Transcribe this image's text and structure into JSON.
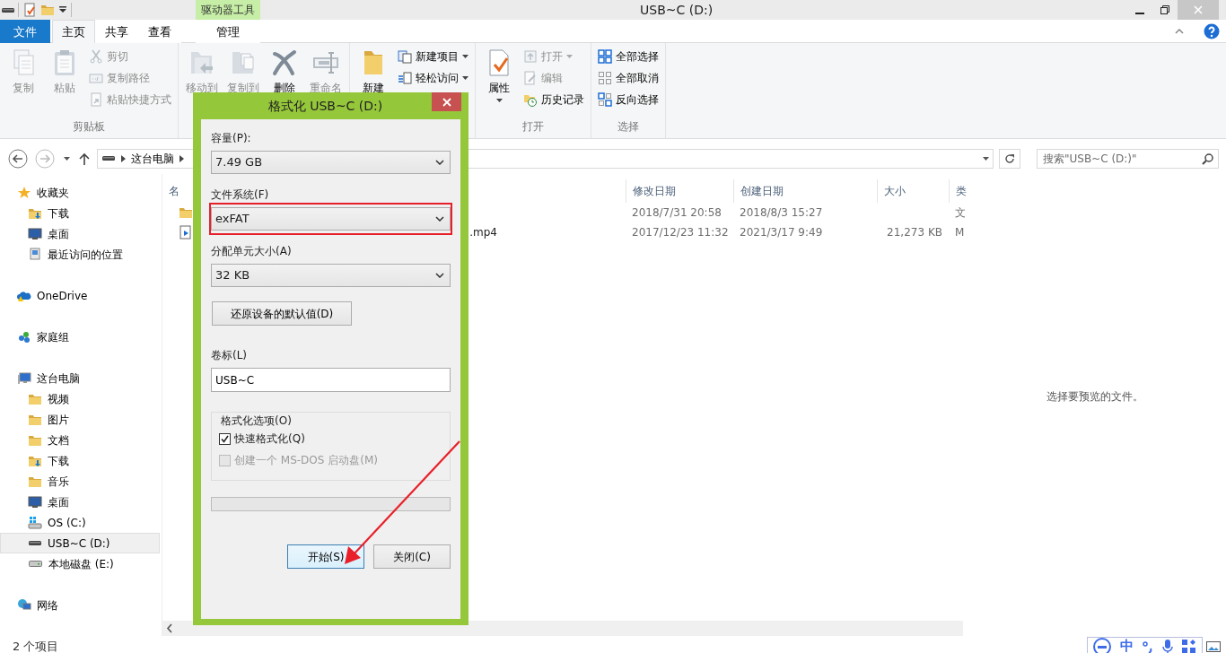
{
  "window": {
    "title": "USB~C (D:)"
  },
  "contextual_header": "驱动器工具",
  "ribbon_tabs": [
    {
      "label": "文件",
      "kind": "file",
      "selected": false
    },
    {
      "label": "主页",
      "kind": "normal",
      "selected": true
    },
    {
      "label": "共享",
      "kind": "normal",
      "selected": false
    },
    {
      "label": "查看",
      "kind": "normal",
      "selected": false
    },
    {
      "label": "管理",
      "kind": "contextual",
      "selected": false
    }
  ],
  "ribbon_groups": [
    {
      "label": "剪贴板",
      "items": [
        {
          "label": "复制",
          "kind": "large",
          "disabled": true,
          "dropdown": false
        },
        {
          "label": "粘贴",
          "kind": "large",
          "disabled": true,
          "dropdown": false
        },
        {
          "label": "剪切",
          "kind": "small",
          "disabled": true,
          "dropdown": false
        },
        {
          "label": "复制路径",
          "kind": "small",
          "disabled": true,
          "dropdown": false
        },
        {
          "label": "粘贴快捷方式",
          "kind": "small",
          "disabled": true,
          "dropdown": false
        }
      ]
    },
    {
      "items": [
        {
          "label": "移动到",
          "kind": "large",
          "disabled": true,
          "dropdown": false
        },
        {
          "label": "复制到",
          "kind": "large",
          "disabled": true,
          "dropdown": false
        },
        {
          "label": "删除",
          "kind": "large",
          "disabled": false,
          "dropdown": false
        },
        {
          "label": "重命名",
          "kind": "large",
          "disabled": true,
          "dropdown": false
        }
      ]
    },
    {
      "items": [
        {
          "label": "新建",
          "kind": "large",
          "disabled": false,
          "dropdown": false
        },
        {
          "label": "新建项目",
          "kind": "small",
          "disabled": false,
          "dropdown": true
        },
        {
          "label": "轻松访问",
          "kind": "small",
          "disabled": false,
          "dropdown": true
        }
      ]
    },
    {
      "label": "打开",
      "items": [
        {
          "label": "属性",
          "kind": "large",
          "disabled": false,
          "dropdown": true
        },
        {
          "label": "打开",
          "kind": "small",
          "disabled": true,
          "dropdown": true
        },
        {
          "label": "编辑",
          "kind": "small",
          "disabled": true,
          "dropdown": false
        },
        {
          "label": "历史记录",
          "kind": "small",
          "disabled": false,
          "dropdown": false
        }
      ]
    },
    {
      "label": "选择",
      "items": [
        {
          "label": "全部选择",
          "kind": "small",
          "disabled": false,
          "dropdown": false
        },
        {
          "label": "全部取消",
          "kind": "small",
          "disabled": false,
          "dropdown": false
        },
        {
          "label": "反向选择",
          "kind": "small",
          "disabled": false,
          "dropdown": false
        }
      ]
    }
  ],
  "address_bar": {
    "breadcrumbs": [
      "这台电脑"
    ]
  },
  "search": {
    "placeholder": "搜索\"USB~C (D:)\""
  },
  "navigation": [
    {
      "label": "收藏夹",
      "selected": false,
      "children": [
        {
          "label": "下载",
          "selected": false
        },
        {
          "label": "桌面",
          "selected": false
        },
        {
          "label": "最近访问的位置",
          "selected": false
        }
      ]
    },
    {
      "label": "OneDrive",
      "selected": false
    },
    {
      "label": "家庭组",
      "selected": false
    },
    {
      "label": "这台电脑",
      "selected": false,
      "children": [
        {
          "label": "视频",
          "selected": false
        },
        {
          "label": "图片",
          "selected": false
        },
        {
          "label": "文档",
          "selected": false
        },
        {
          "label": "下载",
          "selected": false
        },
        {
          "label": "音乐",
          "selected": false
        },
        {
          "label": "桌面",
          "selected": false
        },
        {
          "label": "OS (C:)",
          "selected": false
        },
        {
          "label": "USB~C (D:)",
          "selected": true
        },
        {
          "label": "本地磁盘 (E:)",
          "selected": false
        }
      ]
    },
    {
      "label": "网络",
      "selected": false
    }
  ],
  "file_list": {
    "columns": [
      "名",
      "修改日期",
      "创建日期",
      "大小",
      "类"
    ],
    "rows": [
      {
        "kind": "folder",
        "modified": "2018/7/31 20:58",
        "created": "2018/8/3 15:27",
        "column_5": "文"
      },
      {
        "kind": "video",
        "name": ".mp4",
        "modified": "2017/12/23 11:32",
        "created": "2021/3/17 9:49",
        "size": "21,273 KB",
        "column_5": "M"
      }
    ]
  },
  "preview_pane": {
    "message": "选择要预览的文件。"
  },
  "status_bar": {
    "item_count": "2 个项目"
  },
  "ime_toolbar": {
    "mode": "中"
  },
  "format_dialog": {
    "title": "格式化 USB~C (D:)",
    "fields": [
      {
        "label": "容量(P):",
        "value": "7.49 GB",
        "highlighted": false
      },
      {
        "label": "文件系统(F)",
        "value": "exFAT",
        "highlighted": true
      },
      {
        "label": "分配单元大小(A)",
        "value": "32 KB",
        "highlighted": false
      }
    ],
    "restore_button": "还原设备的默认值(D)",
    "volume_label": {
      "label": "卷标(L)",
      "value": "USB~C"
    },
    "options": {
      "legend": "格式化选项(O)",
      "checkboxes": [
        {
          "label": "快速格式化(Q)",
          "checked": true,
          "disabled": false
        },
        {
          "label": "创建一个 MS-DOS 启动盘(M)",
          "checked": false,
          "disabled": true
        }
      ]
    },
    "progress": {
      "level": 0
    },
    "buttons": [
      {
        "label": "开始(S)",
        "default": true
      },
      {
        "label": "关闭(C)",
        "default": false
      }
    ]
  },
  "annotations": [
    {
      "kind": "arrow"
    }
  ]
}
